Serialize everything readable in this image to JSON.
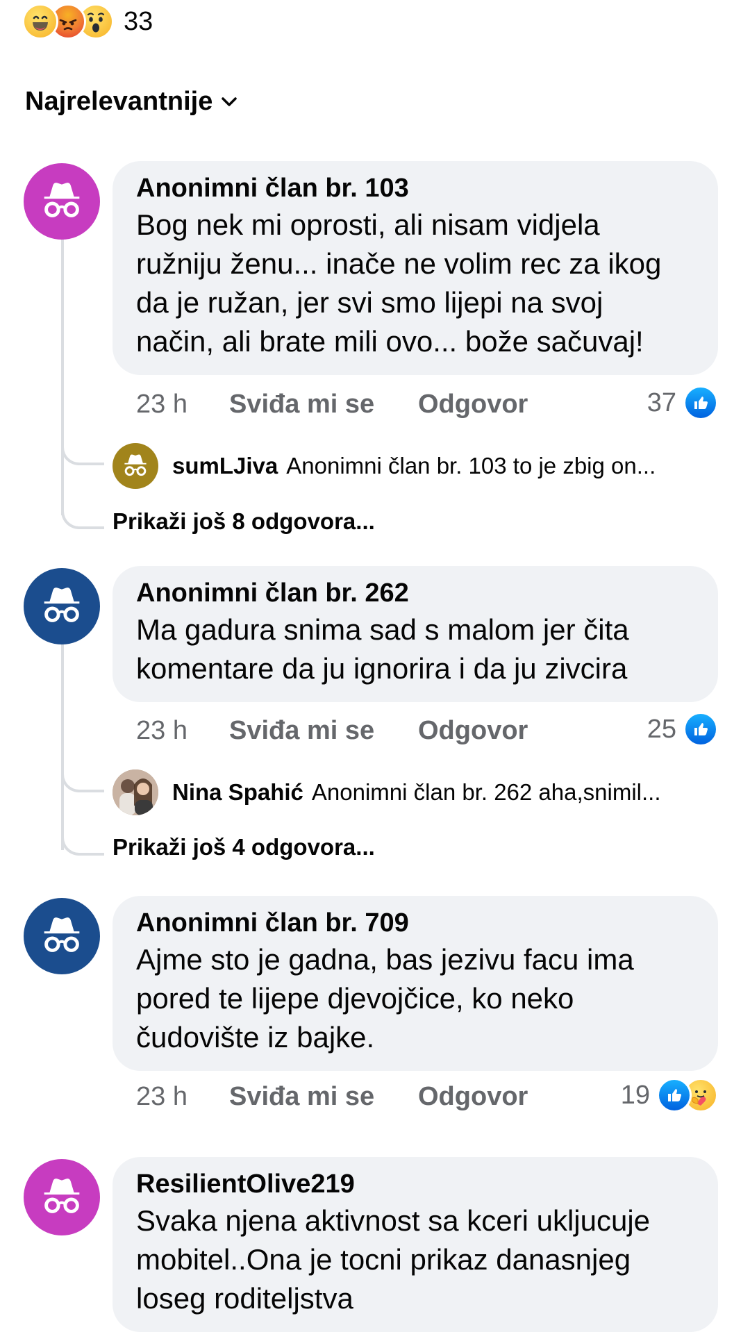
{
  "reactions": {
    "icons": [
      "haha-icon",
      "angry-icon",
      "wow-icon"
    ],
    "count": "33"
  },
  "sort": {
    "label": "Najrelevantnije"
  },
  "comments": [
    {
      "author": "Anonimni član br. 103",
      "lines": [
        "Bog nek mi oprosti, ali nisam vidjela",
        "ružniju ženu... inače ne volim rec za ikog",
        "da je ružan, jer svi smo lijepi na svoj",
        "način, ali brate mili ovo... bože sačuvaj!"
      ],
      "time": "23 h",
      "like_label": "Sviđa mi se",
      "reply_label": "Odgovor",
      "likes": "37",
      "avatar_color": "#c73cc0",
      "reply": {
        "name": "sumLJiva",
        "snippet": "Anonimni član br. 103  to je zbig on...",
        "avatar_color": "#a1841b"
      },
      "more_replies": "Prikaži još 8 odgovora..."
    },
    {
      "author": "Anonimni član br. 262",
      "lines": [
        "Ma gadura snima sad s malom jer čita",
        "komentare da ju ignorira i da ju zivcira"
      ],
      "time": "23 h",
      "like_label": "Sviđa mi se",
      "reply_label": "Odgovor",
      "likes": "25",
      "avatar_color": "#1b4d8e",
      "reply": {
        "name": "Nina Spahić",
        "snippet": "Anonimni član br. 262 aha,snimil..."
      },
      "more_replies": "Prikaži još 4 odgovora..."
    },
    {
      "author": "Anonimni član br. 709",
      "lines": [
        "Ajme sto je gadna, bas jezivu facu ima",
        "pored te lijepe djevojčice, ko neko",
        "čudovište iz bajke."
      ],
      "time": "23 h",
      "like_label": "Sviđa mi se",
      "reply_label": "Odgovor",
      "likes": "19",
      "avatar_color": "#1b4d8e"
    },
    {
      "author": "ResilientOlive219",
      "lines": [
        "Svaka njena aktivnost sa kceri ukljucuje",
        "mobitel..Ona je tocni prikaz danasnjeg",
        "loseg roditeljstva"
      ],
      "avatar_color": "#c73cc0"
    }
  ]
}
